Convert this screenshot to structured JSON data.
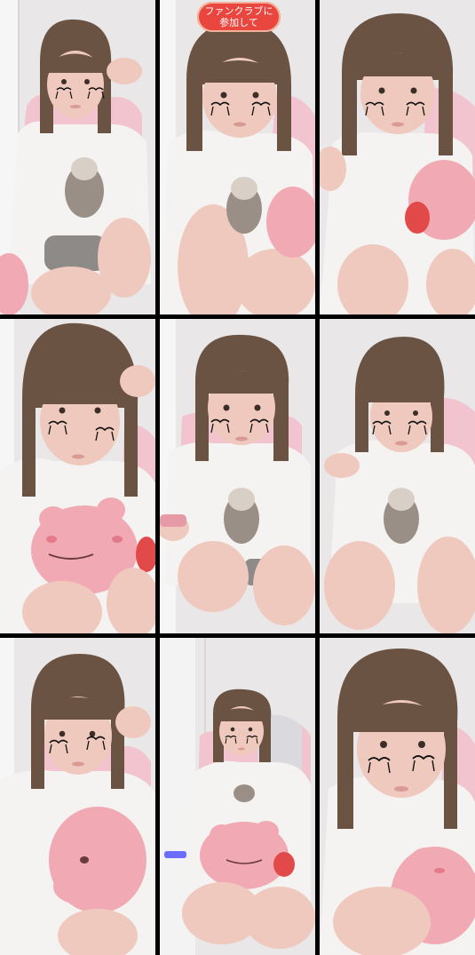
{
  "overlay": {
    "badge_line1": "ファンクラブに",
    "badge_line2": "参加して",
    "accent": "#e8463e"
  },
  "frames": [
    {
      "description": ""
    },
    {
      "description": ""
    },
    {
      "description": ""
    },
    {
      "description": ""
    },
    {
      "description": ""
    },
    {
      "description": ""
    },
    {
      "description": ""
    },
    {
      "description": ""
    },
    {
      "description": ""
    }
  ],
  "colors": {
    "divider": "#000000",
    "wall": "#ece9ea",
    "shirt": "#f4f3f1",
    "hair": "#6b5343",
    "skin": "#efc9bd",
    "plush_pink": "#f1aab3",
    "chair": "#f2c4cf"
  }
}
